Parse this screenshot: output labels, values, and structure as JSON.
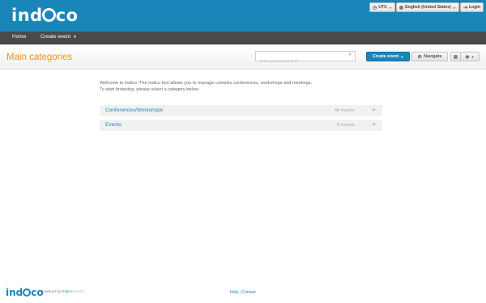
{
  "header": {
    "logo_text": "indico",
    "timezone_label": "UTC",
    "language_label": "English (United States)",
    "login_label": "Login",
    "icons": {
      "timezone": "clock-icon",
      "language": "globe-icon",
      "login": "login-icon"
    }
  },
  "menubar": {
    "items": [
      {
        "label": "Home"
      },
      {
        "label": "Create event"
      }
    ]
  },
  "page": {
    "title": "Main categories",
    "search_placeholder": "Enter your search term",
    "create_event_label": "Create event",
    "navigate_label": "Navigate"
  },
  "welcome": {
    "line1": "Welcome to Indico. The Indico tool allows you to manage complex conferences, workshops and meetings.",
    "line2": "To start browsing, please select a category below."
  },
  "categories": [
    {
      "name": "Conferences/Workshops",
      "count": "48 events"
    },
    {
      "name": "Events",
      "count": "5 events"
    }
  ],
  "footer": {
    "logo_text": "indico",
    "powered_by": "Powered by",
    "powered_link": "Indico",
    "version": "v3.3.2",
    "help": "Help",
    "separator": "|",
    "contact": "Contact"
  },
  "colors": {
    "brand_blue": "#1a85b8",
    "title_orange": "#e9951b",
    "menubar_dark": "#4a4a4a"
  }
}
